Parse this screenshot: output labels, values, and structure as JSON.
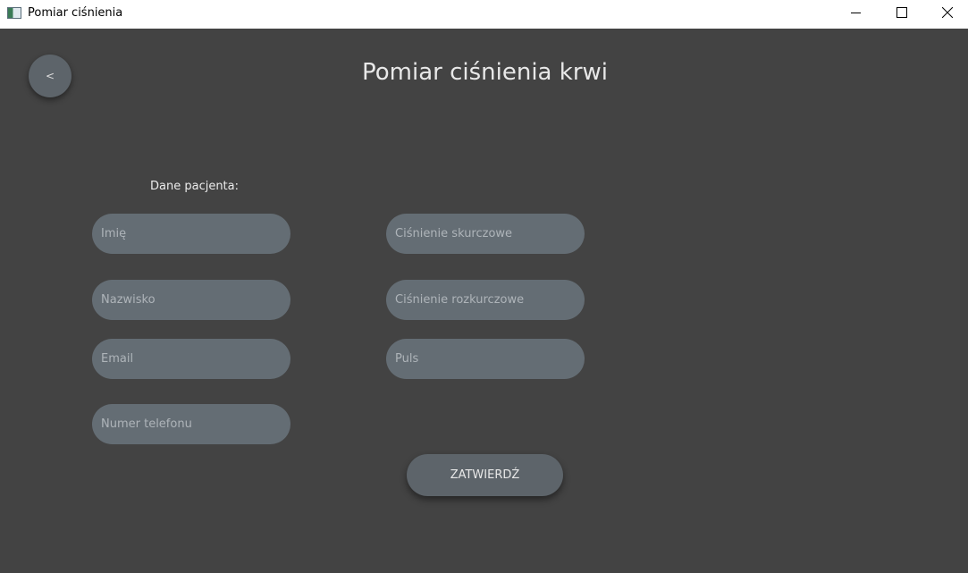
{
  "window": {
    "title": "Pomiar ciśnienia"
  },
  "header": {
    "back_label": "<",
    "title": "Pomiar ciśnienia krwi"
  },
  "form": {
    "section_label": "Dane pacjenta:",
    "first_name": {
      "placeholder": "Imię",
      "value": ""
    },
    "last_name": {
      "placeholder": "Nazwisko",
      "value": ""
    },
    "email": {
      "placeholder": "Email",
      "value": ""
    },
    "phone": {
      "placeholder": "Numer telefonu",
      "value": ""
    },
    "systolic": {
      "placeholder": "Ciśnienie skurczowe",
      "value": ""
    },
    "diastolic": {
      "placeholder": "Ciśnienie rozkurczowe",
      "value": ""
    },
    "pulse": {
      "placeholder": "Puls",
      "value": ""
    },
    "submit_label": "ZATWIERDŹ"
  },
  "icons": {
    "app": "app-window-icon",
    "minimize": "minimize-icon",
    "maximize": "maximize-icon",
    "close": "close-icon"
  },
  "colors": {
    "background": "#434343",
    "field": "#646d74",
    "button": "#5d646a"
  }
}
